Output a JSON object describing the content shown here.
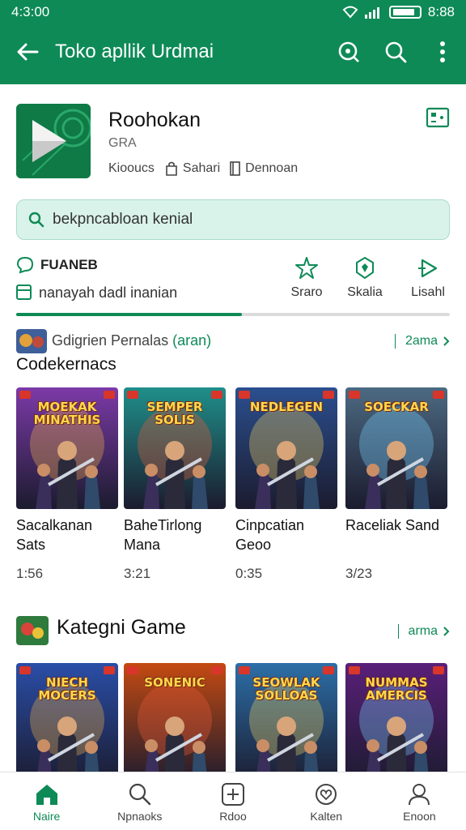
{
  "status": {
    "time": "4:3:00",
    "battery": "8:88"
  },
  "toolbar": {
    "title": "Toko apllik Urdmai"
  },
  "app": {
    "name": "Roohokan",
    "subtitle": "GRA",
    "meta": [
      "Kiooucs",
      "Sahari",
      "Dennoan"
    ]
  },
  "search": {
    "text": "bekpncabloan kenial"
  },
  "filters": {
    "label": "FUANEB",
    "hint": "nanayah dadl inanian",
    "buttons": [
      "Sraro",
      "Skalia",
      "Lisahl"
    ],
    "progress": 0.52
  },
  "section1": {
    "small_prefix": "Gdigrien Pernalas",
    "small_accent": "(aran)",
    "title": "Codekernacs",
    "more": "2ama"
  },
  "games1": [
    {
      "name": "Sacalkanan Sats",
      "time": "1:56",
      "cover_text": "MOEKAK MINATHIS",
      "bg": "#7c3aa8"
    },
    {
      "name": "BaheTirlong Mana",
      "time": "3:21",
      "cover_text": "SEMPER SOLIS",
      "bg": "#1f8f8a"
    },
    {
      "name": "Cinpcatian Geoo",
      "time": "0:35",
      "cover_text": "NEDLEGEN",
      "bg": "#2b4f8f"
    },
    {
      "name": "Raceliak Sand",
      "time": "3/23",
      "cover_text": "SOECKAR",
      "bg": "#4c6a82"
    }
  ],
  "section2": {
    "title": "Kategni Game",
    "more": "arma"
  },
  "games2": [
    {
      "cover_text": "NIECH MOCERS",
      "bg": "#2a4ea8"
    },
    {
      "cover_text": "SONENIC",
      "bg": "#c44a12"
    },
    {
      "cover_text": "SEOWLAK SOLLOAS",
      "bg": "#2c6fa8"
    },
    {
      "cover_text": "NUMMAS AMERCIS",
      "bg": "#5a1f7a"
    }
  ],
  "nav": [
    {
      "label": "Naire",
      "icon": "home-icon"
    },
    {
      "label": "Npnaoks",
      "icon": "search-icon"
    },
    {
      "label": "Rdoo",
      "icon": "add-box-icon"
    },
    {
      "label": "Kalten",
      "icon": "heart-icon"
    },
    {
      "label": "Enoon",
      "icon": "person-icon"
    }
  ],
  "colors": {
    "primary": "#0e8a57",
    "search_bg": "#daf3ea"
  }
}
